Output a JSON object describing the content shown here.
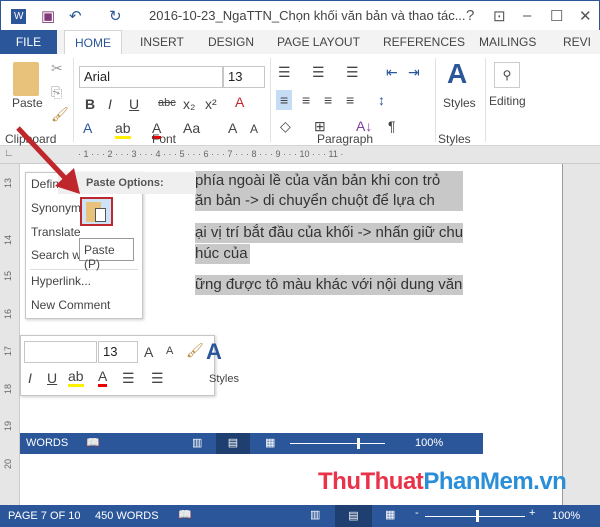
{
  "title": "2016-10-23_NgaTTN_Chọn khối văn bản và thao tác...",
  "titlebar": {
    "help": "?",
    "minimize": "–",
    "maximize": "☐",
    "close": "✕"
  },
  "tabs": [
    "FILE",
    "HOME",
    "INSERT",
    "DESIGN",
    "PAGE LAYOUT",
    "REFERENCES",
    "MAILINGS",
    "REVI"
  ],
  "ribbon": {
    "paste": "Paste",
    "font_name": "Arial",
    "font_size": "13",
    "styles": "Styles",
    "editing": "Editing",
    "groups": {
      "clipboard": "Clipboard",
      "font": "Font",
      "paragraph": "Paragraph",
      "styles": "Styles"
    },
    "font_buttons": [
      "B",
      "I",
      "U",
      "abc",
      "x₂",
      "x²"
    ],
    "aa": "Aa"
  },
  "ruler": "· 1 · · · 2 · · · 3 · · · 4 · · · 5 · · · 6 · · · 7 · · · 8 · · · 9 · · · 10 · · · 11 ·",
  "vruler": [
    "13",
    "14",
    "15",
    "16",
    "17",
    "18",
    "19",
    "20"
  ],
  "document": {
    "lines": [
      "phía ngoài lề của văn bản khi con trỏ",
      "ăn bản -> di chuyển chuột để lựa ch",
      "ại vị trí bắt đầu của khối -> nhấn giữ chuột",
      "húc của khối.",
      "ững được tô màu khác với nội dung văn bả"
    ]
  },
  "context_menu": {
    "items": [
      "Define",
      "Synonyms",
      "Translate",
      "Search with",
      "Hyperlink...",
      "New Comment"
    ],
    "paste_options": "Paste Options:",
    "tooltip": "Paste (P)"
  },
  "mini_toolbar": {
    "font_size": "13",
    "styles": "Styles"
  },
  "inner_status": {
    "words": "WORDS",
    "zoom": "100%"
  },
  "status": {
    "page": "PAGE 7 OF 10",
    "words": "450 WORDS",
    "zoom": "100%"
  },
  "watermark": {
    "part1": "ThuThuat",
    "part2": "PhanMem.vn"
  },
  "colors": {
    "brand": "#2b579a",
    "highlight": "#c8c8c8",
    "arrow": "#c0272d"
  }
}
